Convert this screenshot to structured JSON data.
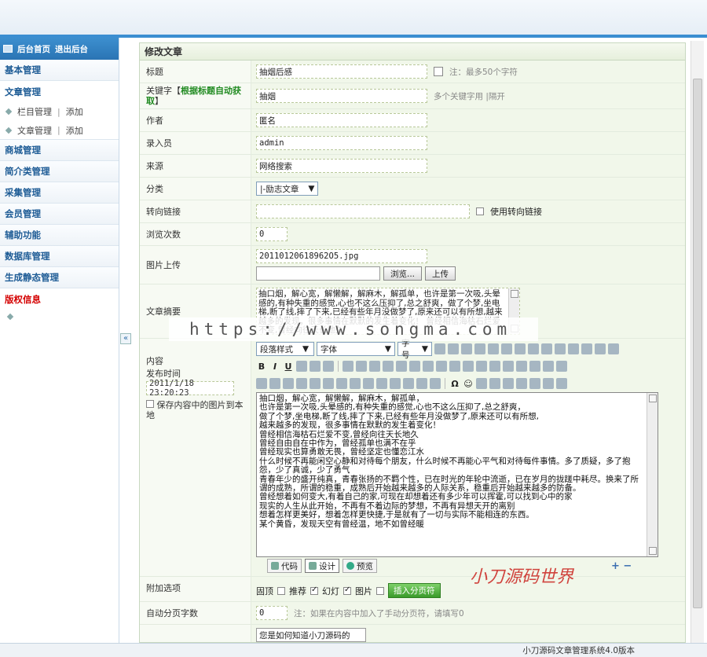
{
  "sidebar": {
    "home": "后台首页",
    "logout": "退出后台",
    "sections": [
      {
        "label": "基本管理"
      },
      {
        "label": "文章管理"
      }
    ],
    "sub_items": [
      {
        "label": "栏目管理",
        "add": "添加"
      },
      {
        "label": "文章管理",
        "add": "添加"
      }
    ],
    "sections2": [
      {
        "label": "商城管理"
      },
      {
        "label": "简介类管理"
      },
      {
        "label": "采集管理"
      },
      {
        "label": "会员管理"
      },
      {
        "label": "辅助功能"
      },
      {
        "label": "数据库管理"
      },
      {
        "label": "生成静态管理"
      },
      {
        "label": "版权信息"
      }
    ],
    "collapse": "«"
  },
  "form": {
    "title": "修改文章",
    "fields": {
      "title_label": "标题",
      "title_value": "抽烟后感",
      "title_hint": "注：最多50个字符",
      "keyword_label": "关键字【",
      "keyword_link": "根据标题自动获取",
      "keyword_close": "】",
      "keyword_value": "抽烟",
      "keyword_hint": "多个关键字用 |隔开",
      "author_label": "作者",
      "author_value": "匿名",
      "editor_label": "录入员",
      "editor_value": "admin",
      "source_label": "来源",
      "source_value": "网络搜索",
      "category_label": "分类",
      "category_value": "|-励志文章",
      "redirect_label": "转向链接",
      "redirect_value": "",
      "redirect_check": "使用转向链接",
      "views_label": "浏览次数",
      "views_value": "0",
      "image_label": "图片上传",
      "image_value": "20110120618962O5.jpg",
      "browse_btn": "浏览...",
      "upload_btn": "上传",
      "summary_label": "文章摘要",
      "summary_text": "抽口烟，解心宽，解懒解，解麻木，解孤单，也许是第一次吸,头晕感的,有种失重的感觉,心也不这么压抑了,总之舒爽，做了个梦,坐电梯,断了线,摔了下来,已经有些年月没做梦了,原来还可以有所想,越来越多的发现，很多事情在默默的发生着变化！ 曾经相信海枯石烂爱不变,曾经向往天长地久",
      "content_label": "内容",
      "pubtime_label": "发布时间",
      "pubtime_value": "2011/1/18 23:20:23",
      "save_images": "保存内容中的图片到本地",
      "extra_label": "附加选项",
      "opt_top": "固顶",
      "opt_recommend": "推荐",
      "opt_slide": "幻灯",
      "opt_image": "图片",
      "insert_page_btn": "插入分页符",
      "autopage_label": "自动分页字数",
      "autopage_value": "0",
      "autopage_hint": "注：如果在内容中加入了手动分页符，请填写0",
      "last_value": "您是如何知道小刀源码的"
    }
  },
  "editor": {
    "style_select": "段落样式",
    "font_select": "字体",
    "size_select": "字号",
    "text": "抽口烟，解心宽，解懒解，解麻木，解孤单，\n也许是第一次吸,头晕感的,有种失重的感觉,心也不这么压抑了,总之舒爽，\n做了个梦,坐电梯,断了线,摔了下来,已经有些年月没做梦了,原来还可以有所想,\n越来越多的发现，很多事情在默默的发生着变化！\n曾经相信海枯石烂爱不变,曾经向往天长地久\n曾经自由自在中作为，曾经孤单也满不在乎\n曾经现实也算勇敢无畏，曾经坚定也懂恋江水\n什么时候不再能闲空心静和对待每个朋友，什么时候不再能心平气和对待每件事情。多了质疑，多了抱怨，少了真诚，少了勇气\n青春年少的盛开纯真，青春张扬的不羁个性，已在时光的年轮中流逝，已在岁月的拢蹉中耗尽。换来了所谓的成熟，所谓的稳重，成熟后开始越来越多的人际关系，稳重后开始越来越多的防备。\n曾经想着如何变大,有着自己的家,可现在却想着还有多少年可以挥霍,可以找到心中的家\n现实的人生从此开始，不再有不着边际的梦想，不再有异想天开的离别\n想着怎样更美好，想着怎样更快捷,于是就有了一切与实际不能相连的东西。\n某个黄昏，发现天空有曾经温，地不如曾经暖",
    "tab_code": "代码",
    "tab_design": "设计",
    "tab_preview": "预览"
  },
  "watermark": "https://www.songma.com",
  "brand_mark": "小刀源码世界",
  "plus_minus": "+ −",
  "statusbar": "小刀源码文章管理系统4.0版本",
  "colors": {
    "accent": "#3b8ed1",
    "form_bg": "#f1f7ea",
    "warning": "#d40000",
    "link_green": "#228b22"
  }
}
